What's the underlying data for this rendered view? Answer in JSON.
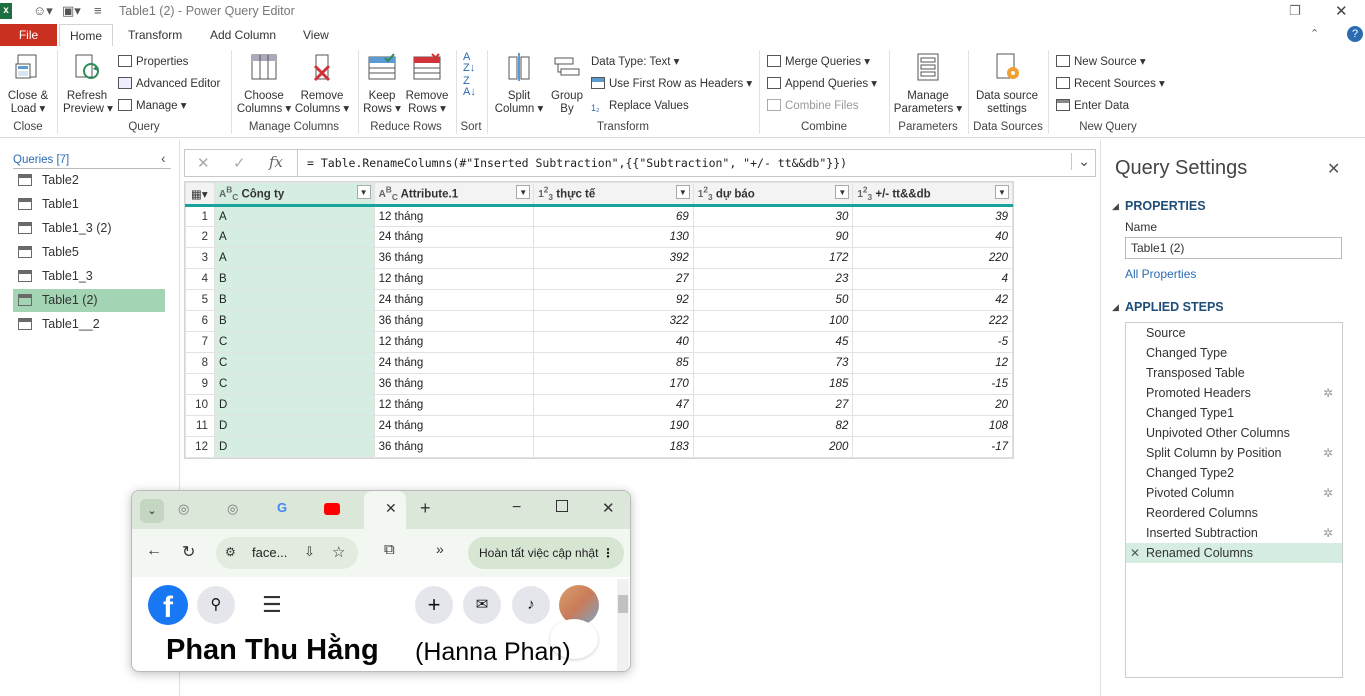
{
  "window": {
    "title": "Table1 (2) - Power Query Editor"
  },
  "tabs": [
    "File",
    "Home",
    "Transform",
    "Add Column",
    "View"
  ],
  "ribbon": {
    "close": {
      "btn": "Close &\nLoad ▾",
      "group": "Close"
    },
    "query": {
      "refresh": "Refresh\nPreview ▾",
      "properties": "Properties",
      "advanced": "Advanced Editor",
      "manage": "Manage ▾",
      "group": "Query"
    },
    "manage_columns": {
      "choose": "Choose\nColumns ▾",
      "remove": "Remove\nColumns ▾",
      "group": "Manage Columns"
    },
    "reduce_rows": {
      "keep": "Keep\nRows ▾",
      "remove": "Remove\nRows ▾",
      "group": "Reduce Rows"
    },
    "sort": {
      "group": "Sort"
    },
    "transform": {
      "split": "Split\nColumn ▾",
      "groupby": "Group\nBy",
      "datatype": "Data Type: Text ▾",
      "firstrow": "Use First Row as Headers ▾",
      "replace": "Replace Values",
      "group": "Transform"
    },
    "combine": {
      "merge": "Merge Queries ▾",
      "append": "Append Queries ▾",
      "combine_files": "Combine Files",
      "group": "Combine"
    },
    "parameters": {
      "manage": "Manage\nParameters ▾",
      "group": "Parameters"
    },
    "data_sources": {
      "settings": "Data source\nsettings",
      "group": "Data Sources"
    },
    "new_query": {
      "new_source": "New Source ▾",
      "recent": "Recent Sources ▾",
      "enter": "Enter Data",
      "group": "New Query"
    }
  },
  "queries": {
    "header": "Queries [7]",
    "items": [
      "Table2",
      "Table1",
      "Table1_3 (2)",
      "Table5",
      "Table1_3",
      "Table1 (2)",
      "Table1__2"
    ],
    "selected": "Table1 (2)"
  },
  "formula": "= Table.RenameColumns(#\"Inserted Subtraction\",{{\"Subtraction\", \"+/- tt&&db\"}})",
  "grid": {
    "columns": [
      {
        "type": "ABC",
        "name": "Công ty"
      },
      {
        "type": "ABC",
        "name": "Attribute.1"
      },
      {
        "type": "123",
        "name": "thực tế"
      },
      {
        "type": "123",
        "name": "dự báo"
      },
      {
        "type": "123",
        "name": "+/- tt&&db"
      }
    ],
    "rows": [
      [
        "1",
        "A",
        "12 tháng",
        "69",
        "30",
        "39"
      ],
      [
        "2",
        "A",
        "24 tháng",
        "130",
        "90",
        "40"
      ],
      [
        "3",
        "A",
        "36 tháng",
        "392",
        "172",
        "220"
      ],
      [
        "4",
        "B",
        "12 tháng",
        "27",
        "23",
        "4"
      ],
      [
        "5",
        "B",
        "24 tháng",
        "92",
        "50",
        "42"
      ],
      [
        "6",
        "B",
        "36 tháng",
        "322",
        "100",
        "222"
      ],
      [
        "7",
        "C",
        "12 tháng",
        "40",
        "45",
        "-5"
      ],
      [
        "8",
        "C",
        "24 tháng",
        "85",
        "73",
        "12"
      ],
      [
        "9",
        "C",
        "36 tháng",
        "170",
        "185",
        "-15"
      ],
      [
        "10",
        "D",
        "12 tháng",
        "47",
        "27",
        "20"
      ],
      [
        "11",
        "D",
        "24 tháng",
        "190",
        "82",
        "108"
      ],
      [
        "12",
        "D",
        "36 tháng",
        "183",
        "200",
        "-17"
      ]
    ]
  },
  "settings": {
    "title": "Query Settings",
    "properties": "PROPERTIES",
    "name_label": "Name",
    "name_value": "Table1 (2)",
    "all_props": "All Properties",
    "applied": "APPLIED STEPS",
    "steps": [
      "Source",
      "Changed Type",
      "Transposed Table",
      "Promoted Headers",
      "Changed Type1",
      "Unpivoted Other Columns",
      "Split Column by Position",
      "Changed Type2",
      "Pivoted Column",
      "Reordered Columns",
      "Inserted Subtraction",
      "Renamed Columns"
    ],
    "gear_steps": [
      3,
      6,
      8,
      10
    ]
  },
  "browser": {
    "url": "face...",
    "update": "Hoàn tất việc cập nhật",
    "profile_name": "Phan Thu Hằng",
    "alt_name": "(Hanna Phan)"
  },
  "colors": {
    "file_tab": "#c9301f",
    "accent_teal": "#1aa39b",
    "selected_query": "#a3d4b4",
    "link": "#2b6cb0",
    "facebook": "#1877f2"
  }
}
